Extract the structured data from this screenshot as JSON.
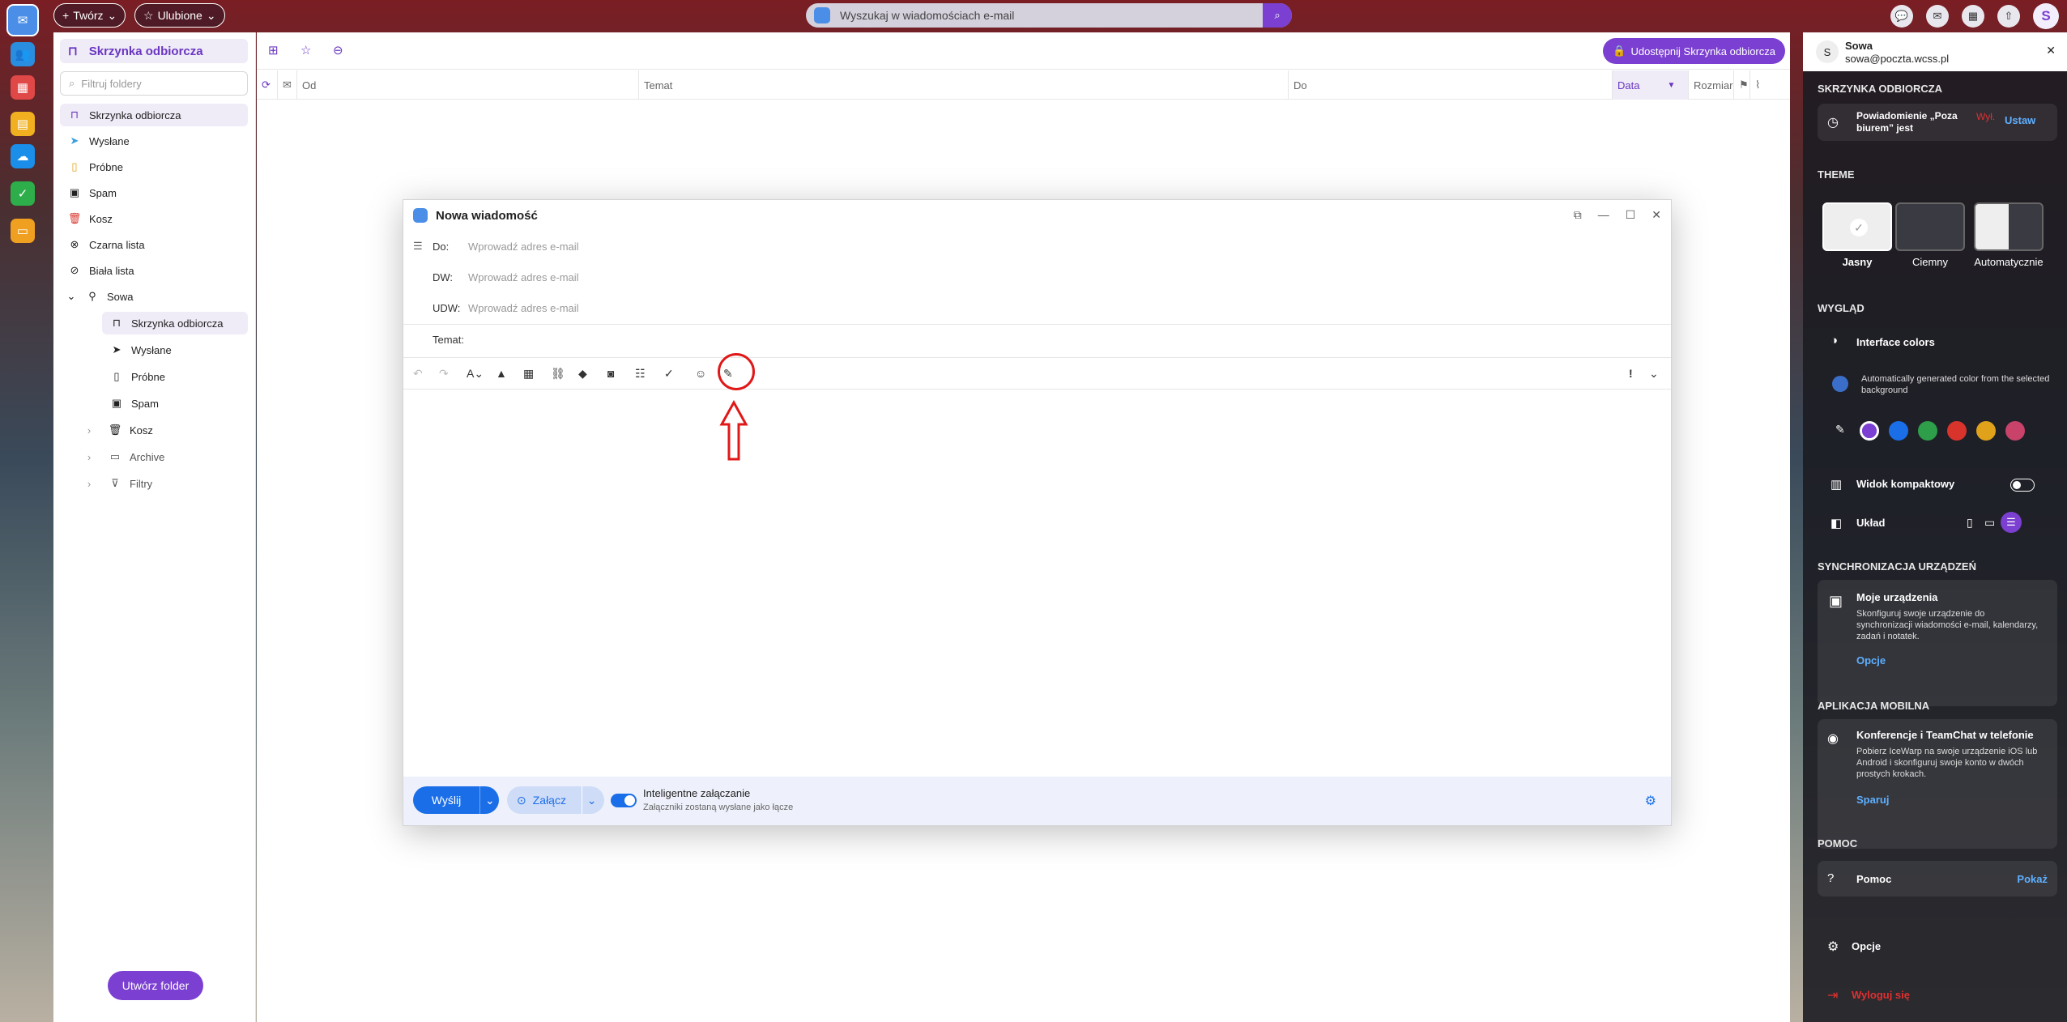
{
  "topbar": {
    "create_label": "Twórz",
    "favorites_label": "Ulubione",
    "search_placeholder": "Wyszukaj w wiadomościach e-mail",
    "avatar_letter": "S"
  },
  "folders": {
    "title": "Skrzynka odbiorcza",
    "filter_placeholder": "Filtruj foldery",
    "items": [
      {
        "label": "Skrzynka odbiorcza"
      },
      {
        "label": "Wysłane"
      },
      {
        "label": "Próbne"
      },
      {
        "label": "Spam"
      },
      {
        "label": "Kosz"
      },
      {
        "label": "Czarna lista"
      },
      {
        "label": "Biała lista"
      }
    ],
    "account": "Sowa",
    "sub_items": [
      {
        "label": "Skrzynka odbiorcza"
      },
      {
        "label": "Wysłane"
      },
      {
        "label": "Próbne"
      },
      {
        "label": "Spam"
      },
      {
        "label": "Kosz"
      },
      {
        "label": "Archive"
      },
      {
        "label": "Filtry"
      }
    ],
    "create_folder": "Utwórz folder"
  },
  "main": {
    "share_label": "Udostępnij Skrzynka odbiorcza",
    "columns": {
      "from": "Od",
      "subject": "Temat",
      "to": "Do",
      "date": "Data",
      "size": "Rozmiar"
    }
  },
  "compose": {
    "title": "Nowa wiadomość",
    "to_label": "Do:",
    "cc_label": "DW:",
    "bcc_label": "UDW:",
    "address_placeholder": "Wprowadź adres e-mail",
    "subject_label": "Temat:",
    "send": "Wyślij",
    "attach": "Załącz",
    "smart_title": "Inteligentne załączanie",
    "smart_sub": "Załączniki zostaną wysłane jako łącze"
  },
  "right_panel": {
    "user_name": "Sowa",
    "user_email": "sowa@poczta.wcss.pl",
    "avatar_letter": "S",
    "inbox_section": "SKRZYNKA ODBIORCZA",
    "ooo_text": "Powiadomienie „Poza biurem” jest",
    "ooo_status": "Wył.",
    "ooo_action": "Ustaw",
    "theme_section": "THEME",
    "themes": [
      "Jasny",
      "Ciemny",
      "Automatycznie"
    ],
    "look_section": "WYGLĄD",
    "interface_colors": "Interface colors",
    "auto_color_text": "Automatically generated color from the selected background",
    "swatches": [
      "#7b3fd1",
      "#1a6ee8",
      "#2e9e4a",
      "#d8342c",
      "#e0a21a",
      "#c8426a"
    ],
    "compact_view": "Widok kompaktowy",
    "layout": "Układ",
    "sync_section": "SYNCHRONIZACJA URZĄDZEŃ",
    "devices_title": "Moje urządzenia",
    "devices_text": "Skonfiguruj swoje urządzenie do synchronizacji wiadomości e-mail, kalendarzy, zadań i notatek.",
    "devices_action": "Opcje",
    "mobile_section": "APLIKACJA MOBILNA",
    "mobile_title": "Konferencje i TeamChat w telefonie",
    "mobile_text": "Pobierz IceWarp na swoje urządzenie iOS lub Android i skonfiguruj swoje konto w dwóch prostych krokach.",
    "mobile_action": "Sparuj",
    "help_section": "POMOC",
    "help_label": "Pomoc",
    "help_action": "Pokaż",
    "options": "Opcje",
    "logout": "Wyloguj się"
  }
}
